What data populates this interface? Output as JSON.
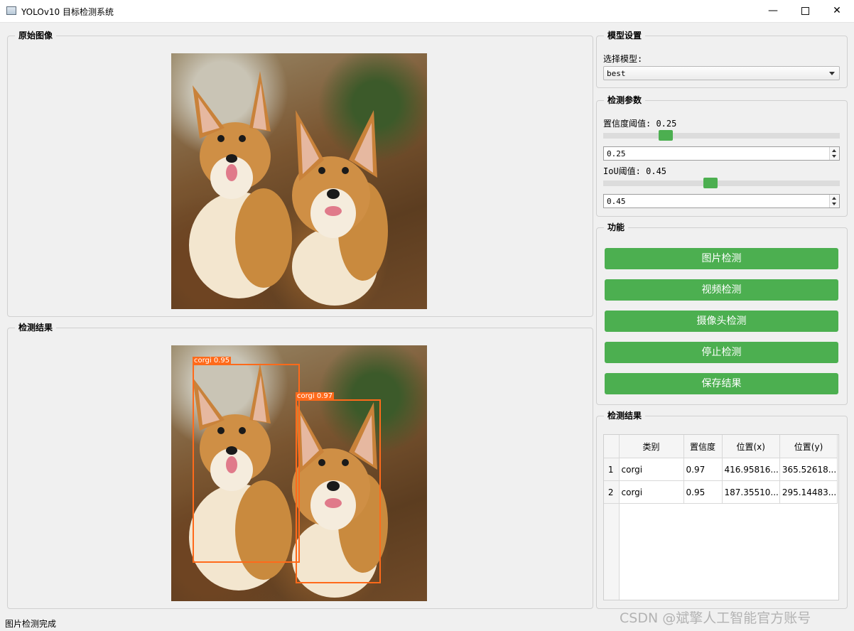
{
  "window": {
    "title": "YOLOv10 目标检测系统",
    "minimize": "—",
    "close": "✕"
  },
  "original_panel": {
    "title": "原始图像"
  },
  "result_panel": {
    "title": "检测结果"
  },
  "detections": [
    {
      "label": "corgi 0.97"
    },
    {
      "label": "corgi 0.95"
    }
  ],
  "model_settings": {
    "title": "模型设置",
    "select_label": "选择模型:",
    "selected_model": "best"
  },
  "detect_params": {
    "title": "检测参数",
    "conf_label": "置信度阈值: 0.25",
    "conf_value": "0.25",
    "conf_level": 0.25,
    "iou_label": "IoU阈值: 0.45",
    "iou_value": "0.45",
    "iou_level": 0.45
  },
  "functions": {
    "title": "功能",
    "image_detect": "图片检测",
    "video_detect": "视频检测",
    "camera_detect": "摄像头检测",
    "stop_detect": "停止检测",
    "save_result": "保存结果"
  },
  "results_table": {
    "title": "检测结果",
    "columns": [
      "类别",
      "置信度",
      "位置(x)",
      "位置(y)"
    ],
    "rows": [
      {
        "index": "1",
        "class": "corgi",
        "conf": "0.97",
        "x": "416.95816...",
        "y": "365.52618..."
      },
      {
        "index": "2",
        "class": "corgi",
        "conf": "0.95",
        "x": "187.35510...",
        "y": "295.14483..."
      }
    ]
  },
  "status": "图片检测完成",
  "watermark": "CSDN @斌擎人工智能官方账号",
  "colors": {
    "accent": "#4caf50",
    "box": "#ff6a1a"
  }
}
